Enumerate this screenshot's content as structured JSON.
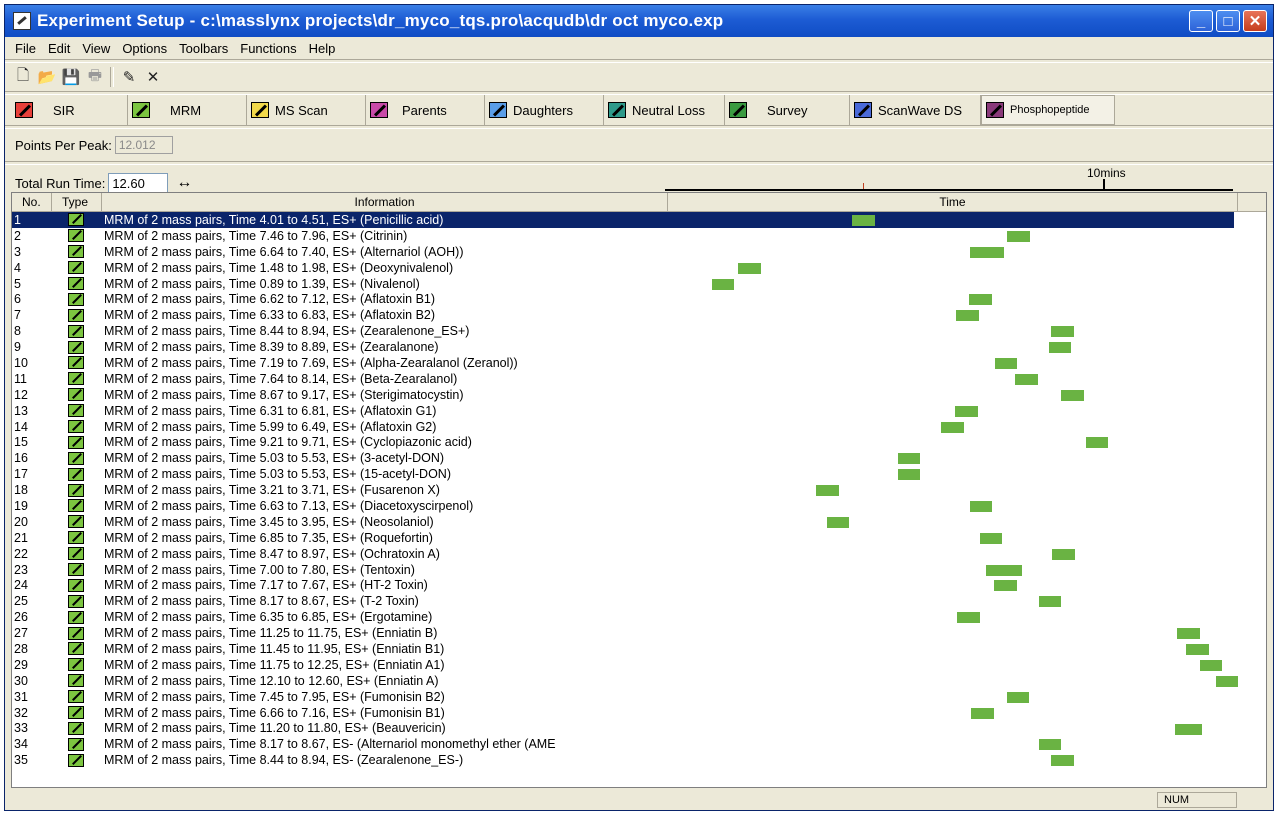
{
  "window": {
    "title": "Experiment Setup - c:\\masslynx projects\\dr_myco_tqs.pro\\acqudb\\dr oct myco.exp",
    "minimize": "_",
    "maximize": "□",
    "close": "✕"
  },
  "menu": [
    "File",
    "Edit",
    "View",
    "Options",
    "Toolbars",
    "Functions",
    "Help"
  ],
  "toolbar": {
    "new": "🗋",
    "open": "📂",
    "save": "💾",
    "print": "🖶",
    "edit": "✎",
    "delete": "✕"
  },
  "functions": [
    "SIR",
    "MRM",
    "MS Scan",
    "Parents",
    "Daughters",
    "Neutral Loss",
    "Survey",
    "ScanWave DS",
    "Phosphopeptide"
  ],
  "points_per_peak": {
    "label": "Points Per Peak:",
    "value": "12.012"
  },
  "total_run_time": {
    "label": "Total Run Time:",
    "value": "12.60",
    "arrow": "↔"
  },
  "ruler": {
    "label": "10mins",
    "total_minutes": 12.6
  },
  "columns": {
    "no": "No.",
    "type": "Type",
    "information": "Information",
    "time": "Time"
  },
  "rows": [
    {
      "no": "1",
      "info": "MRM of 2 mass pairs, Time 4.01 to 4.51, ES+ (Penicillic acid)",
      "start": 4.01,
      "end": 4.51
    },
    {
      "no": "2",
      "info": "MRM of 2 mass pairs, Time 7.46 to 7.96, ES+ (Citrinin)",
      "start": 7.46,
      "end": 7.96
    },
    {
      "no": "3",
      "info": "MRM of 2 mass pairs, Time 6.64 to 7.40, ES+ (Alternariol (AOH))",
      "start": 6.64,
      "end": 7.4
    },
    {
      "no": "4",
      "info": "MRM of 2 mass pairs, Time 1.48 to 1.98, ES+ (Deoxynivalenol)",
      "start": 1.48,
      "end": 1.98
    },
    {
      "no": "5",
      "info": "MRM of 2 mass pairs, Time 0.89 to 1.39, ES+ (Nivalenol)",
      "start": 0.89,
      "end": 1.39
    },
    {
      "no": "6",
      "info": "MRM of 2 mass pairs, Time 6.62 to 7.12, ES+ (Aflatoxin B1)",
      "start": 6.62,
      "end": 7.12
    },
    {
      "no": "7",
      "info": "MRM of 2 mass pairs, Time 6.33 to 6.83, ES+ (Aflatoxin B2)",
      "start": 6.33,
      "end": 6.83
    },
    {
      "no": "8",
      "info": "MRM of 2 mass pairs, Time 8.44 to 8.94, ES+ (Zearalenone_ES+)",
      "start": 8.44,
      "end": 8.94
    },
    {
      "no": "9",
      "info": "MRM of 2 mass pairs, Time 8.39 to 8.89, ES+ (Zearalanone)",
      "start": 8.39,
      "end": 8.89
    },
    {
      "no": "10",
      "info": "MRM of 2 mass pairs, Time 7.19 to 7.69, ES+ (Alpha-Zearalanol (Zeranol))",
      "start": 7.19,
      "end": 7.69
    },
    {
      "no": "11",
      "info": "MRM of 2 mass pairs, Time 7.64 to 8.14, ES+ (Beta-Zearalanol)",
      "start": 7.64,
      "end": 8.14
    },
    {
      "no": "12",
      "info": "MRM of 2 mass pairs, Time 8.67 to 9.17, ES+ (Sterigimatocystin)",
      "start": 8.67,
      "end": 9.17
    },
    {
      "no": "13",
      "info": "MRM of 2 mass pairs, Time 6.31 to 6.81, ES+ (Aflatoxin G1)",
      "start": 6.31,
      "end": 6.81
    },
    {
      "no": "14",
      "info": "MRM of 2 mass pairs, Time 5.99 to 6.49, ES+ (Aflatoxin G2)",
      "start": 5.99,
      "end": 6.49
    },
    {
      "no": "15",
      "info": "MRM of 2 mass pairs, Time 9.21 to 9.71, ES+ (Cyclopiazonic acid)",
      "start": 9.21,
      "end": 9.71
    },
    {
      "no": "16",
      "info": "MRM of 2 mass pairs, Time 5.03 to 5.53, ES+ (3-acetyl-DON)",
      "start": 5.03,
      "end": 5.53
    },
    {
      "no": "17",
      "info": "MRM of 2 mass pairs, Time 5.03 to 5.53, ES+ (15-acetyl-DON)",
      "start": 5.03,
      "end": 5.53
    },
    {
      "no": "18",
      "info": "MRM of 2 mass pairs, Time 3.21 to 3.71, ES+ (Fusarenon X)",
      "start": 3.21,
      "end": 3.71
    },
    {
      "no": "19",
      "info": "MRM of 2 mass pairs, Time 6.63 to 7.13, ES+ (Diacetoxyscirpenol)",
      "start": 6.63,
      "end": 7.13
    },
    {
      "no": "20",
      "info": "MRM of 2 mass pairs, Time 3.45 to 3.95, ES+ (Neosolaniol)",
      "start": 3.45,
      "end": 3.95
    },
    {
      "no": "21",
      "info": "MRM of 2 mass pairs, Time 6.85 to 7.35, ES+ (Roquefortin)",
      "start": 6.85,
      "end": 7.35
    },
    {
      "no": "22",
      "info": "MRM of 2 mass pairs, Time 8.47 to 8.97, ES+ (Ochratoxin A)",
      "start": 8.47,
      "end": 8.97
    },
    {
      "no": "23",
      "info": "MRM of 2 mass pairs, Time 7.00 to 7.80, ES+ (Tentoxin)",
      "start": 7.0,
      "end": 7.8
    },
    {
      "no": "24",
      "info": "MRM of 2 mass pairs, Time 7.17 to 7.67, ES+ (HT-2 Toxin)",
      "start": 7.17,
      "end": 7.67
    },
    {
      "no": "25",
      "info": "MRM of 2 mass pairs, Time 8.17 to 8.67, ES+ (T-2 Toxin)",
      "start": 8.17,
      "end": 8.67
    },
    {
      "no": "26",
      "info": "MRM of 2 mass pairs, Time 6.35 to 6.85, ES+ (Ergotamine)",
      "start": 6.35,
      "end": 6.85
    },
    {
      "no": "27",
      "info": "MRM of 2 mass pairs, Time 11.25 to 11.75, ES+ (Enniatin B)",
      "start": 11.25,
      "end": 11.75
    },
    {
      "no": "28",
      "info": "MRM of 2 mass pairs, Time 11.45 to 11.95, ES+ (Enniatin B1)",
      "start": 11.45,
      "end": 11.95
    },
    {
      "no": "29",
      "info": "MRM of 2 mass pairs, Time 11.75 to 12.25, ES+ (Enniatin A1)",
      "start": 11.75,
      "end": 12.25
    },
    {
      "no": "30",
      "info": "MRM of 2 mass pairs, Time 12.10 to 12.60, ES+ (Enniatin A)",
      "start": 12.1,
      "end": 12.6
    },
    {
      "no": "31",
      "info": "MRM of 2 mass pairs, Time 7.45 to 7.95, ES+ (Fumonisin B2)",
      "start": 7.45,
      "end": 7.95
    },
    {
      "no": "32",
      "info": "MRM of 2 mass pairs, Time 6.66 to 7.16, ES+ (Fumonisin B1)",
      "start": 6.66,
      "end": 7.16
    },
    {
      "no": "33",
      "info": "MRM of 2 mass pairs, Time 11.20 to 11.80, ES+ (Beauvericin)",
      "start": 11.2,
      "end": 11.8
    },
    {
      "no": "34",
      "info": "MRM of 2 mass pairs, Time 8.17 to 8.67, ES- (Alternariol monomethyl ether (AME",
      "start": 8.17,
      "end": 8.67
    },
    {
      "no": "35",
      "info": "MRM of 2 mass pairs, Time 8.44 to 8.94, ES- (Zearalenone_ES-)",
      "start": 8.44,
      "end": 8.94
    }
  ],
  "selected_row": "1",
  "status": {
    "num": "NUM"
  },
  "colors": {
    "bar": "#6ab343",
    "selection": "#0a246a",
    "titlebar": "#1d5cd4"
  }
}
